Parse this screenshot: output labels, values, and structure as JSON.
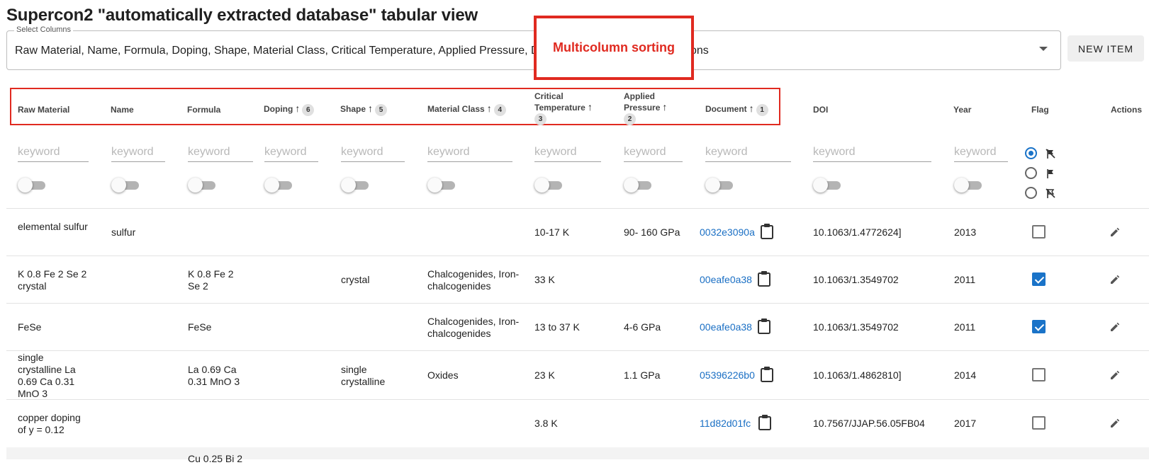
{
  "page_title": "Supercon2 \"automatically extracted database\" tabular view",
  "select_columns": {
    "label": "Select Columns",
    "value": "Raw Material, Name, Formula, Doping, Shape, Material Class, Critical Temperature, Applied Pressure, Document, DOI, Year, Flag, Actions"
  },
  "new_item_label": "NEW ITEM",
  "annotation_label": "Multicolumn sorting",
  "columns": [
    {
      "label": "Raw Material"
    },
    {
      "label": "Name"
    },
    {
      "label": "Formula"
    },
    {
      "label": "Doping",
      "sort_arrow": "↑",
      "sort_order": "6"
    },
    {
      "label": "Shape",
      "sort_arrow": "↑",
      "sort_order": "5"
    },
    {
      "label": "Material Class",
      "sort_arrow": "↑",
      "sort_order": "4"
    },
    {
      "label": "Critical Temperature",
      "line1": "Critical",
      "line2": "Temperature",
      "sort_arrow": "↑",
      "sort_order": "3"
    },
    {
      "label": "Applied Pressure",
      "line1": "Applied",
      "line2": "Pressure",
      "sort_arrow": "↑",
      "sort_order": "2"
    },
    {
      "label": "Document",
      "sort_arrow": "↑",
      "sort_order": "1"
    },
    {
      "label": "DOI"
    },
    {
      "label": "Year"
    },
    {
      "label": "Flag"
    },
    {
      "label": "Actions"
    }
  ],
  "filter_placeholder": "keyword",
  "flag_filter": {
    "selected": "all"
  },
  "rows": [
    {
      "raw_material": "elemental sulfur",
      "name": "sulfur",
      "formula": "",
      "doping": "",
      "shape": "",
      "material_class": "",
      "critical_temperature": "10-17 K",
      "applied_pressure": "90- 160 GPa",
      "document": "0032e3090a",
      "doi": "10.1063/1.4772624]",
      "year": "2013",
      "flagged": false
    },
    {
      "raw_material": "K 0.8 Fe 2 Se 2 crystal",
      "name": "",
      "formula": "K 0.8 Fe 2 Se 2",
      "doping": "",
      "shape": "crystal",
      "material_class": "Chalcogenides, Iron-chalcogenides",
      "critical_temperature": "33 K",
      "applied_pressure": "",
      "document": "00eafe0a38",
      "doi": "10.1063/1.3549702",
      "year": "2011",
      "flagged": true
    },
    {
      "raw_material": "FeSe",
      "name": "",
      "formula": "FeSe",
      "doping": "",
      "shape": "",
      "material_class": "Chalcogenides, Iron-chalcogenides",
      "critical_temperature": "13 to 37 K",
      "applied_pressure": "4-6 GPa",
      "document": "00eafe0a38",
      "doi": "10.1063/1.3549702",
      "year": "2011",
      "flagged": true
    },
    {
      "raw_material": "single crystalline La 0.69 Ca 0.31 MnO 3",
      "name": "",
      "formula": "La 0.69 Ca 0.31 MnO 3",
      "doping": "",
      "shape": "single crystalline",
      "material_class": "Oxides",
      "critical_temperature": "23 K",
      "applied_pressure": "1.1 GPa",
      "document": "05396226b0",
      "doi": "10.1063/1.4862810]",
      "year": "2014",
      "flagged": false
    },
    {
      "raw_material": "copper doping of y = 0.12",
      "name": "",
      "formula": "",
      "doping": "",
      "shape": "",
      "material_class": "",
      "critical_temperature": "3.8 K",
      "applied_pressure": "",
      "document": "11d82d01fc",
      "doi": "10.7567/JJAP.56.05FB04",
      "year": "2017",
      "flagged": false
    },
    {
      "raw_material": "",
      "name": "",
      "formula": "Cu 0.25 Bi 2",
      "doping": "",
      "shape": "",
      "material_class": "",
      "critical_temperature": "",
      "applied_pressure": "",
      "document": "",
      "doi": "",
      "year": "",
      "flagged": false
    }
  ]
}
